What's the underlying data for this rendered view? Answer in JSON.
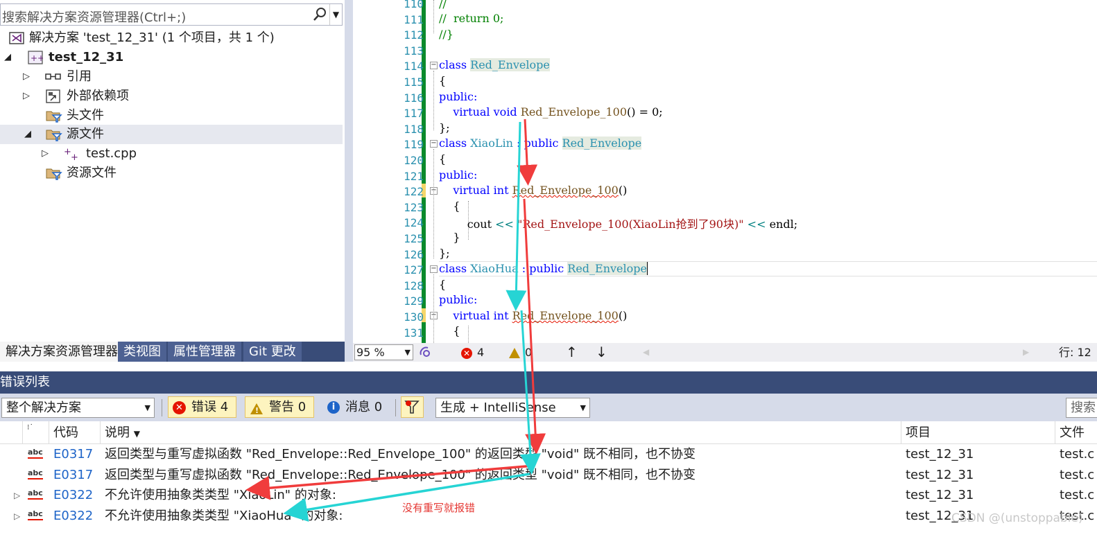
{
  "solution_explorer": {
    "search_placeholder": "搜索解决方案资源管理器(Ctrl+;)",
    "tree": {
      "solution": "解决方案 'test_12_31' (1 个项目，共 1 个)",
      "project": "test_12_31",
      "references": "引用",
      "external_deps": "外部依赖项",
      "headers": "头文件",
      "sources": "源文件",
      "source_file": "test.cpp",
      "resources": "资源文件"
    },
    "tabs": [
      "解决方案资源管理器",
      "类视图",
      "属性管理器",
      "Git 更改"
    ]
  },
  "editor": {
    "line_numbers": [
      "110",
      "111",
      "112",
      "113",
      "114",
      "115",
      "116",
      "117",
      "118",
      "119",
      "120",
      "121",
      "122",
      "123",
      "124",
      "125",
      "126",
      "127",
      "128",
      "129",
      "130",
      "131"
    ],
    "tokens": {
      "l110": "//",
      "l111": "//  return 0;",
      "l112": "//}",
      "class_kw": "class",
      "red_envelope": "Red_Envelope",
      "brace_open": "{",
      "public": "public:",
      "virtual": "virtual",
      "void": "void",
      "int": "int",
      "func": "Red_Envelope_100",
      "pure_tail": "() = 0;",
      "close_semicolon": "};",
      "xiaolin": "XiaoLin",
      "xiaohua": "XiaoHua",
      "colon_public": " : public ",
      "parens": "()",
      "cout": "cout",
      "shift": "<<",
      "str_lin": "\"Red_Envelope_100(XiaoLin抢到了90块)\"",
      "endl": "endl;",
      "brace_close": "}"
    },
    "status": {
      "zoom": "95 %",
      "errors": "4",
      "warnings": "0",
      "position": "行: 12"
    }
  },
  "error_list": {
    "title": "错误列表",
    "scope": "整个解决方案",
    "errors_btn": "错误 4",
    "warnings_btn": "警告 0",
    "messages_btn": "消息 0",
    "build_filter": "生成 + IntelliSense",
    "search_ph": "搜索",
    "headers": {
      "code": "代码",
      "desc": "说明",
      "project": "项目",
      "file": "文件"
    },
    "rows": [
      {
        "code": "E0317",
        "desc": "返回类型与重写虚拟函数 \"Red_Envelope::Red_Envelope_100\" 的返回类型 \"void\" 既不相同，也不协变",
        "project": "test_12_31",
        "file": "test.c"
      },
      {
        "code": "E0317",
        "desc": "返回类型与重写虚拟函数 \"Red_Envelope::Red_Envelope_100\" 的返回类型 \"void\" 既不相同，也不协变",
        "project": "test_12_31",
        "file": "test.c"
      },
      {
        "code": "E0322",
        "desc": "不允许使用抽象类类型 \"XiaoLin\" 的对象:",
        "project": "test_12_31",
        "file": "test.c"
      },
      {
        "code": "E0322",
        "desc": "不允许使用抽象类类型 \"XiaoHua\" 的对象:",
        "project": "test_12_31",
        "file": "test.c"
      }
    ]
  },
  "annotation": "没有重写就报错",
  "watermark": "CSDN @(unstoppable)",
  "colors": {
    "arrow_red": "#f03c3c",
    "arrow_cyan": "#26d4d4",
    "tab_bar": "#394c78",
    "change_bar": "#0b8a2c"
  }
}
